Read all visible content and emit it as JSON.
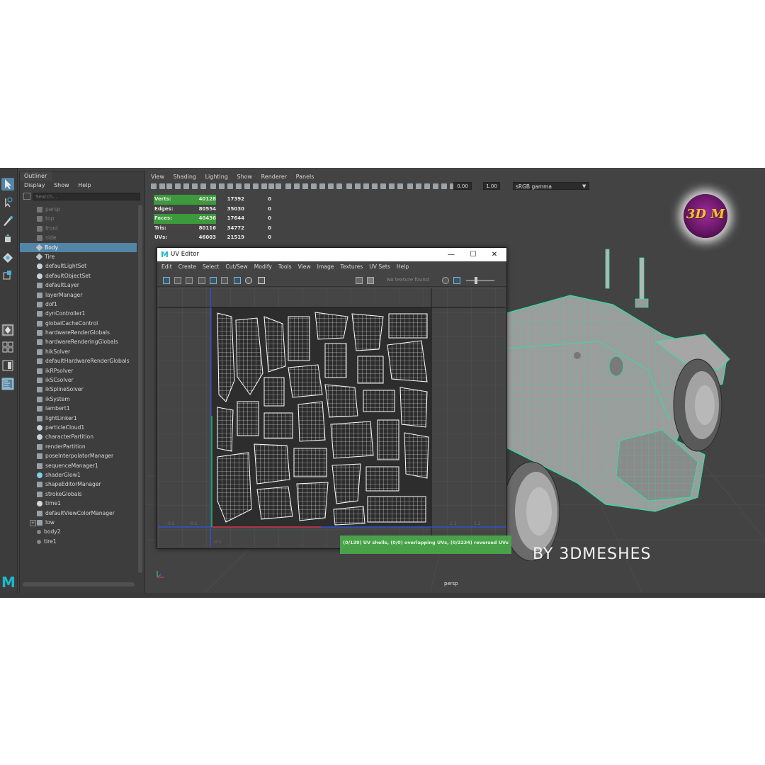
{
  "outliner": {
    "title": "Outliner",
    "menu": [
      "Display",
      "Show",
      "Help"
    ],
    "search_placeholder": "Search...",
    "items": [
      {
        "label": "persp",
        "icon": "camera-icon",
        "dim": true
      },
      {
        "label": "top",
        "icon": "camera-icon",
        "dim": true
      },
      {
        "label": "front",
        "icon": "camera-icon",
        "dim": true
      },
      {
        "label": "side",
        "icon": "camera-icon",
        "dim": true
      },
      {
        "label": "Body",
        "icon": "mesh-icon",
        "selected": true
      },
      {
        "label": "Tire",
        "icon": "mesh-icon"
      },
      {
        "label": "defaultLightSet",
        "icon": "set-icon"
      },
      {
        "label": "defaultObjectSet",
        "icon": "set-icon"
      },
      {
        "label": "defaultLayer",
        "icon": "layer-icon"
      },
      {
        "label": "layerManager",
        "icon": "node-icon"
      },
      {
        "label": "dof1",
        "icon": "node-icon"
      },
      {
        "label": "dynController1",
        "icon": "node-icon"
      },
      {
        "label": "globalCacheControl",
        "icon": "node-icon"
      },
      {
        "label": "hardwareRenderGlobals",
        "icon": "node-icon"
      },
      {
        "label": "hardwareRenderingGlobals",
        "icon": "node-icon"
      },
      {
        "label": "hikSolver",
        "icon": "node-icon"
      },
      {
        "label": "defaultHardwareRenderGlobals",
        "icon": "node-icon"
      },
      {
        "label": "ikRPsolver",
        "icon": "node-icon"
      },
      {
        "label": "ikSCsolver",
        "icon": "node-icon"
      },
      {
        "label": "ikSplineSolver",
        "icon": "node-icon"
      },
      {
        "label": "ikSystem",
        "icon": "node-icon"
      },
      {
        "label": "lambert1",
        "icon": "node-icon"
      },
      {
        "label": "lightLinker1",
        "icon": "node-icon"
      },
      {
        "label": "particleCloud1",
        "icon": "set-icon"
      },
      {
        "label": "characterPartition",
        "icon": "set-icon"
      },
      {
        "label": "renderPartition",
        "icon": "node-icon"
      },
      {
        "label": "poseInterpolatorManager",
        "icon": "node-icon"
      },
      {
        "label": "sequenceManager1",
        "icon": "node-icon"
      },
      {
        "label": "shaderGlow1",
        "icon": "glow-icon"
      },
      {
        "label": "shapeEditorManager",
        "icon": "node-icon"
      },
      {
        "label": "strokeGlobals",
        "icon": "node-icon"
      },
      {
        "label": "time1",
        "icon": "clock-icon"
      },
      {
        "label": "defaultViewColorManager",
        "icon": "node-icon"
      },
      {
        "label": "low",
        "icon": "layer-icon",
        "expandable": true
      },
      {
        "label": "body2",
        "icon": "dot-icon"
      },
      {
        "label": "tire1",
        "icon": "dot-icon"
      }
    ]
  },
  "viewport": {
    "menu": [
      "View",
      "Shading",
      "Lighting",
      "Show",
      "Renderer",
      "Panels"
    ],
    "exposure": "0.00",
    "gamma": "1.00",
    "color_space": "sRGB gamma",
    "camera_label": "persp",
    "hud": [
      {
        "label": "Verts:",
        "v1": "40128",
        "v2": "17392",
        "v3": "0",
        "highlight": true
      },
      {
        "label": "Edges:",
        "v1": "80554",
        "v2": "35030",
        "v3": "0",
        "highlight": false
      },
      {
        "label": "Faces:",
        "v1": "40436",
        "v2": "17644",
        "v3": "0",
        "highlight": true
      },
      {
        "label": "Tris:",
        "v1": "80116",
        "v2": "34772",
        "v3": "0",
        "highlight": false
      },
      {
        "label": "UVs:",
        "v1": "46003",
        "v2": "21519",
        "v3": "0",
        "highlight": false
      }
    ],
    "logo_text": "3D M",
    "watermark": "BY 3DMESHES"
  },
  "uv_editor": {
    "title": "UV Editor",
    "menu": [
      "Edit",
      "Create",
      "Select",
      "Cut/Sew",
      "Modify",
      "Tools",
      "View",
      "Image",
      "Textures",
      "UV Sets",
      "Help"
    ],
    "texture_placeholder": "No texture found",
    "status": "(0/139) UV shells, (0/0) overlapping UVs, (0/2234) reversed UVs"
  },
  "colors": {
    "ui_bg": "#444444",
    "selection": "#5285a6",
    "hud_highlight": "#3c9a3c",
    "wireframe": "#2fe0a0"
  }
}
